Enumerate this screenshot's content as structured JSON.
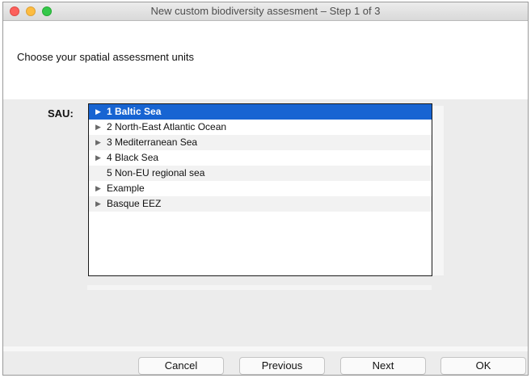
{
  "window": {
    "title": "New custom biodiversity assesment – Step 1 of 3"
  },
  "header": {
    "prompt": "Choose your spatial assessment units"
  },
  "sau": {
    "label": "SAU:",
    "items": [
      {
        "label": "1 Baltic Sea",
        "expandable": true,
        "selected": true
      },
      {
        "label": "2 North-East Atlantic Ocean",
        "expandable": true,
        "selected": false
      },
      {
        "label": "3 Mediterranean Sea",
        "expandable": true,
        "selected": false
      },
      {
        "label": "4 Black Sea",
        "expandable": true,
        "selected": false
      },
      {
        "label": "5 Non-EU regional sea",
        "expandable": false,
        "selected": false
      },
      {
        "label": "Example",
        "expandable": true,
        "selected": false
      },
      {
        "label": "Basque EEZ",
        "expandable": true,
        "selected": false
      }
    ]
  },
  "buttons": {
    "cancel": "Cancel",
    "previous": "Previous",
    "next": "Next",
    "ok": "OK"
  },
  "colors": {
    "selection": "#1764d2",
    "close": "#fc605c",
    "minimize": "#fdbc40",
    "maximize": "#34c84a"
  },
  "icons": {
    "expand": "triangle-right-icon"
  }
}
